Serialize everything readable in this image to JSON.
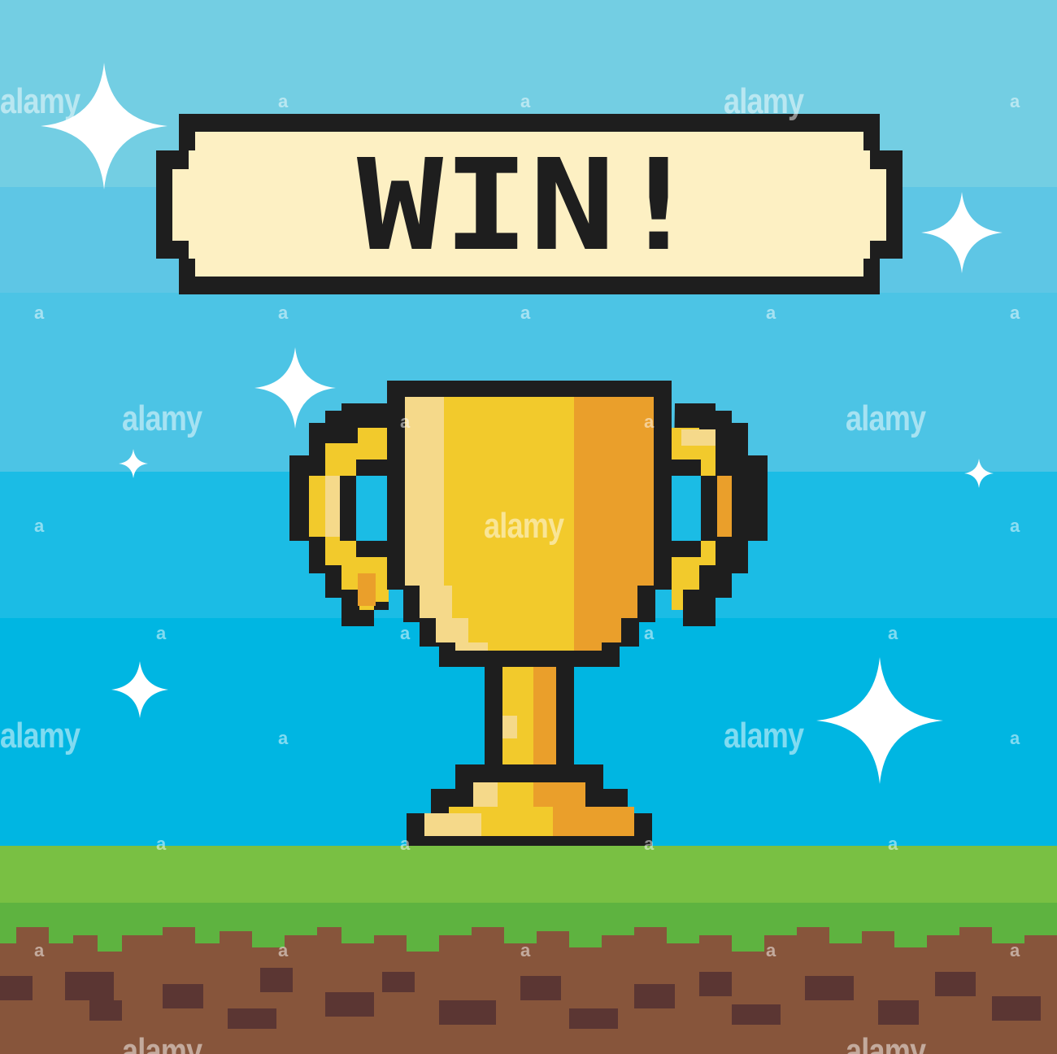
{
  "banner": {
    "text": "WIN!"
  },
  "watermark": {
    "text": "alamy",
    "mark": "a"
  },
  "colors": {
    "sky_top": "#73cee3",
    "sky_bottom": "#00b6e2",
    "banner_fill": "#fdf0c3",
    "outline": "#1e1e1e",
    "gold": "#f2ca2c",
    "gold_dark": "#ea9f2b",
    "gold_light": "#f5d98a",
    "grass": "#79c043",
    "grass_dark": "#5eb340",
    "dirt": "#87553b",
    "dirt_dark": "#5b3633",
    "sparkle": "#ffffff"
  },
  "icons": [
    "sparkle-icon",
    "trophy-icon"
  ]
}
